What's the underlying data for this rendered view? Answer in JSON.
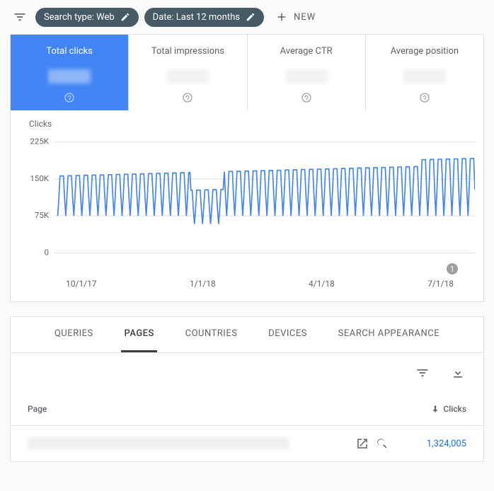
{
  "filters": {
    "search_type": "Search type: Web",
    "date": "Date: Last 12 months",
    "new": "NEW"
  },
  "metrics": [
    {
      "label": "Total clicks",
      "active": true
    },
    {
      "label": "Total impressions",
      "active": false
    },
    {
      "label": "Average CTR",
      "active": false
    },
    {
      "label": "Average position",
      "active": false
    }
  ],
  "chart": {
    "y_title": "Clicks",
    "y_ticks": [
      "225K",
      "150K",
      "75K",
      "0"
    ],
    "x_ticks": [
      "10/1/17",
      "1/1/18",
      "4/1/18",
      "7/1/18"
    ],
    "tooltip_badge": "1"
  },
  "chart_data": {
    "type": "line",
    "title": "Clicks",
    "ylabel": "Clicks",
    "ylim": [
      0,
      225000
    ],
    "lo": 75000,
    "hi": 165000,
    "weeks": 52,
    "x_ticks": [
      "10/1/17",
      "1/1/18",
      "4/1/18",
      "7/1/18"
    ]
  },
  "tabs": [
    "QUERIES",
    "PAGES",
    "COUNTRIES",
    "DEVICES",
    "SEARCH APPEARANCE"
  ],
  "active_tab": "PAGES",
  "table": {
    "page_header": "Page",
    "clicks_header": "Clicks",
    "rows": [
      {
        "clicks": "1,324,005"
      }
    ]
  }
}
